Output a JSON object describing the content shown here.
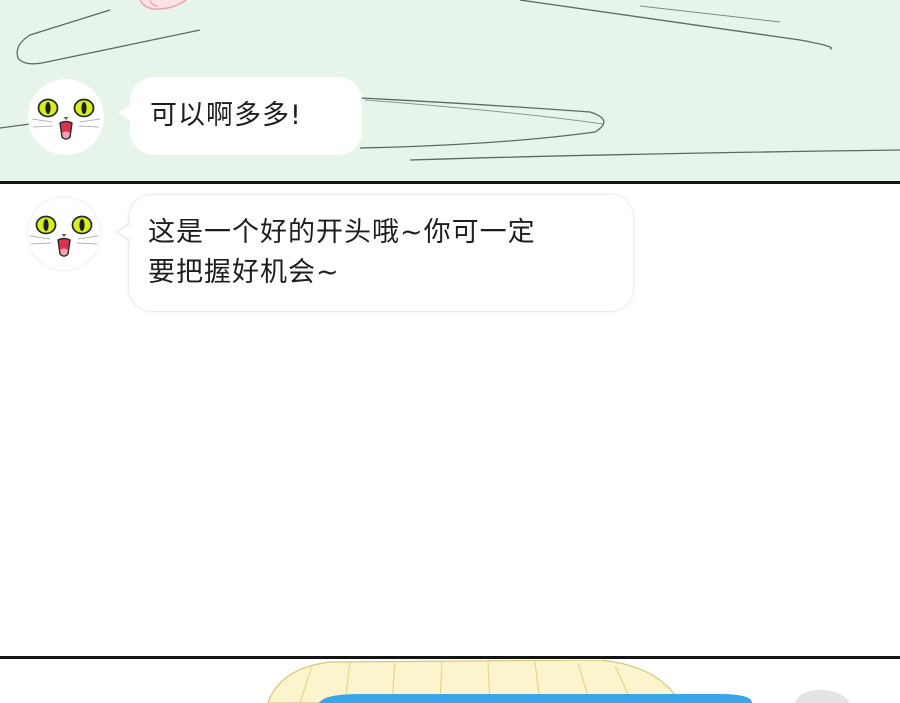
{
  "panels": {
    "top": {
      "background": "#e7f4ea",
      "message": "可以啊多多!"
    },
    "middle": {
      "background": "#ffffff",
      "message_lines": [
        "这是一个好的开头哦~你可一定",
        "要把握好机会~"
      ]
    },
    "bottom": {
      "accent_color": "#3aa6ea",
      "hair_color": "#fbf4cc"
    }
  },
  "speaker": {
    "avatar_icon": "cat-face-icon",
    "eye_color": "#d7ef1c"
  }
}
